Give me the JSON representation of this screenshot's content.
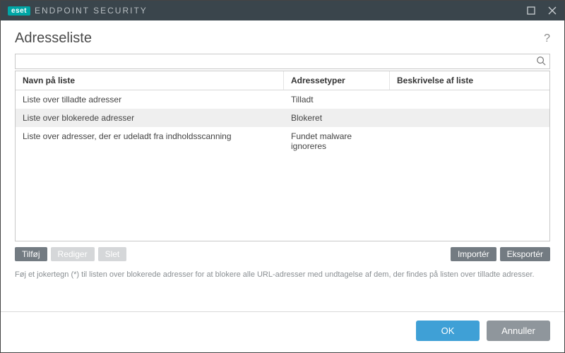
{
  "titlebar": {
    "brand_badge": "eset",
    "brand_title": "ENDPOINT SECURITY"
  },
  "page": {
    "title": "Adresseliste",
    "help_tooltip": "?"
  },
  "search": {
    "value": "",
    "placeholder": ""
  },
  "table": {
    "columns": {
      "name": "Navn på liste",
      "type": "Adressetyper",
      "desc": "Beskrivelse af liste"
    },
    "rows": [
      {
        "name": "Liste over tilladte adresser",
        "type": "Tilladt",
        "desc": "",
        "selected": false
      },
      {
        "name": "Liste over blokerede adresser",
        "type": "Blokeret",
        "desc": "",
        "selected": true
      },
      {
        "name": "Liste over adresser, der er udeladt fra indholdsscanning",
        "type": "Fundet malware ignoreres",
        "desc": "",
        "selected": false
      }
    ]
  },
  "actions": {
    "add": "Tilføj",
    "edit": "Rediger",
    "delete": "Slet",
    "import": "Importér",
    "export": "Eksportér"
  },
  "hint": "Føj et jokertegn (*) til listen over blokerede adresser for at blokere alle URL-adresser med undtagelse af dem, der findes på listen over tilladte adresser.",
  "footer": {
    "ok": "OK",
    "cancel": "Annuller"
  }
}
